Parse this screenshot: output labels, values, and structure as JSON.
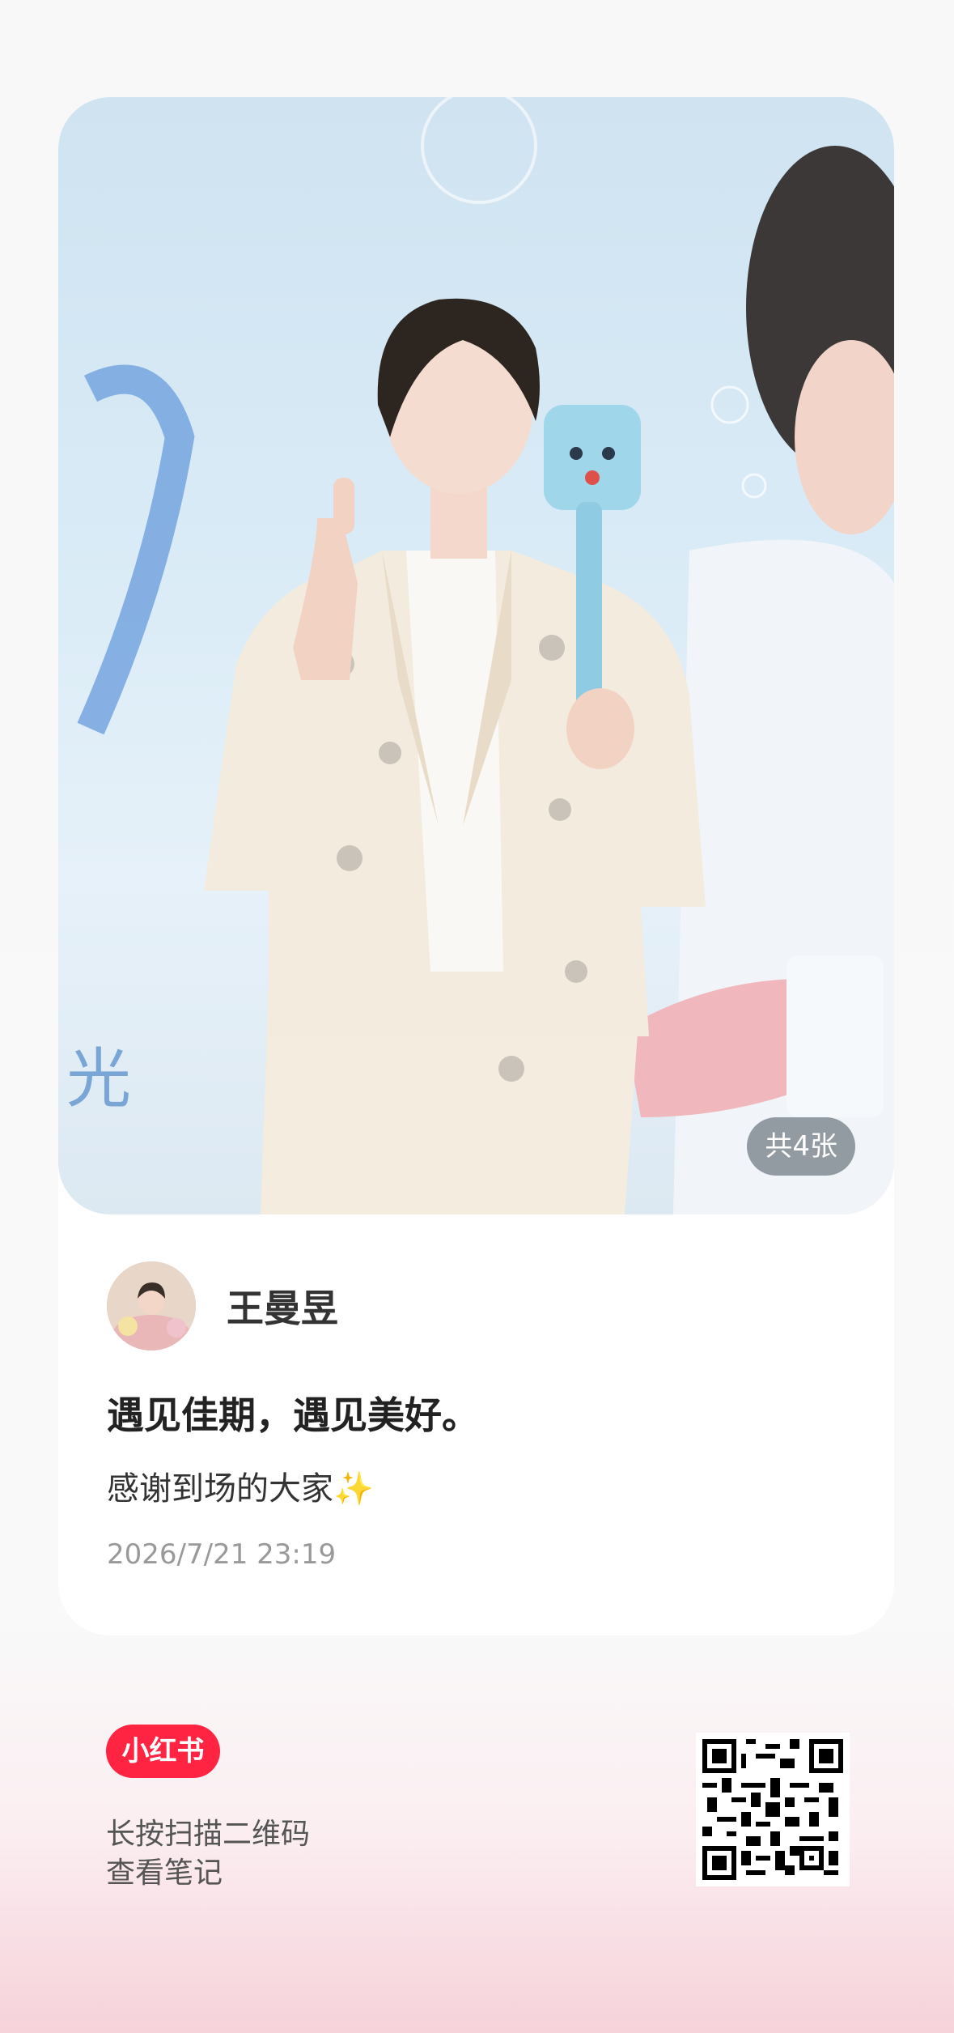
{
  "note": {
    "photo_count": "共4张",
    "author_name": "王曼昱",
    "title": "遇见佳期，遇见美好。",
    "description": "感谢到场的大家✨",
    "timestamp": "2026/7/21 23:19"
  },
  "footer": {
    "brand": "小红书",
    "hint_line1": "长按扫描二维码",
    "hint_line2": "查看笔记"
  },
  "colors": {
    "brand": "#ff2442",
    "card": "#ffffff",
    "meta_text": "#999999"
  },
  "icons": [
    "qr-code-icon"
  ]
}
